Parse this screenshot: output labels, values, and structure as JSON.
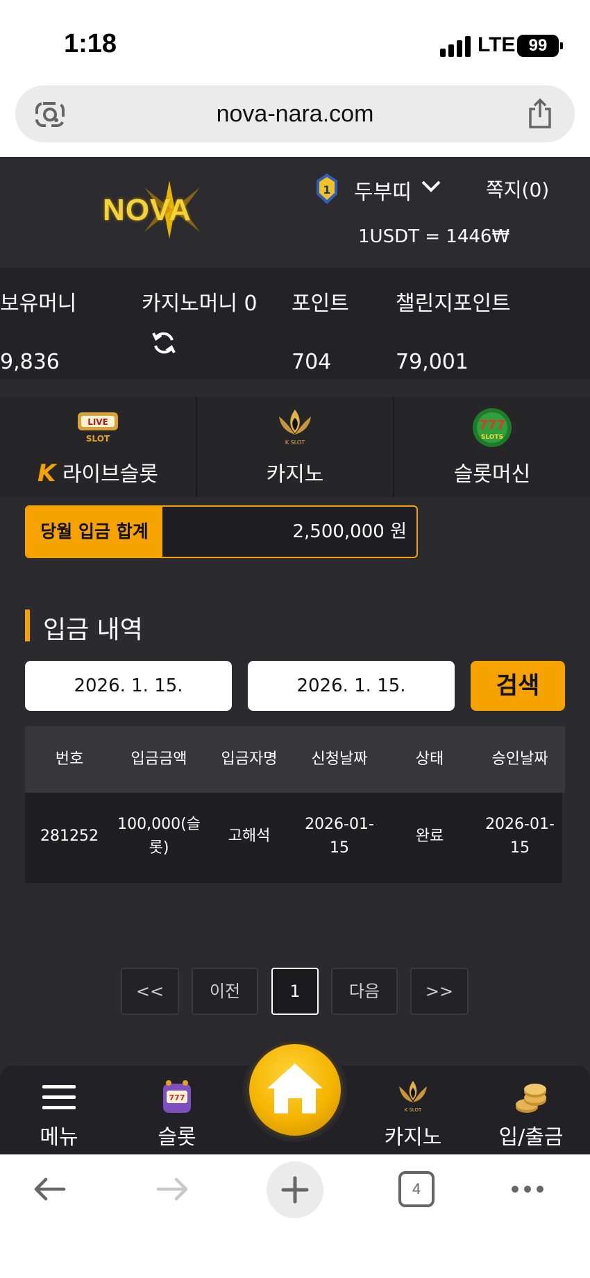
{
  "status_bar": {
    "time": "1:18",
    "network": "LTE",
    "battery": "99"
  },
  "url_bar": {
    "url": "nova-nara.com"
  },
  "header": {
    "logo_text": "NOVA",
    "level": "1",
    "username": "두부띠",
    "messages": "쪽지(0)",
    "exchange_rate": "1USDT = 1446₩"
  },
  "balances": {
    "money_label": "보유머니",
    "money_value": "9,836",
    "casino_label": "카지노머니 0",
    "point_label": "포인트",
    "point_value": "704",
    "challenge_label": "챌린지포인트",
    "challenge_value": "79,001"
  },
  "game_tabs": [
    {
      "label": "라이브슬롯",
      "icon": "live-slot-icon"
    },
    {
      "label": "카지노",
      "icon": "k-slot-lotus-icon"
    },
    {
      "label": "슬롯머신",
      "icon": "777-slots-icon"
    }
  ],
  "deposit_total": {
    "label": "당월 입금 합계",
    "value": "2,500,000 원"
  },
  "section_title": "입금 내역",
  "filters": {
    "start_date": "2026. 1. 15.",
    "end_date": "2026. 1. 15.",
    "search_label": "검색"
  },
  "table": {
    "headers": [
      "번호",
      "입금금액",
      "입금자명",
      "신청날짜",
      "상태",
      "승인날짜"
    ],
    "rows": [
      {
        "no": "281252",
        "amount_1": "100,000(슬",
        "amount_2": "롯)",
        "depositor": "고해석",
        "request_1": "2026-01-",
        "request_2": "15",
        "status": "완료",
        "approve_1": "2026-01-",
        "approve_2": "15"
      }
    ]
  },
  "pagination": {
    "first": "<<",
    "prev": "이전",
    "current": "1",
    "next": "다음",
    "last": ">>"
  },
  "bottom_nav": [
    {
      "label": "메뉴",
      "icon": "hamburger-menu-icon"
    },
    {
      "label": "슬롯",
      "icon": "slot-machine-icon"
    },
    {
      "label": "카지노",
      "icon": "casino-lotus-icon"
    },
    {
      "label": "입/출금",
      "icon": "coins-icon"
    }
  ],
  "browser_toolbar": {
    "tab_count": "4"
  },
  "colors": {
    "accent": "#f6a300",
    "background": "#2b2a2f",
    "panel": "#232327"
  }
}
